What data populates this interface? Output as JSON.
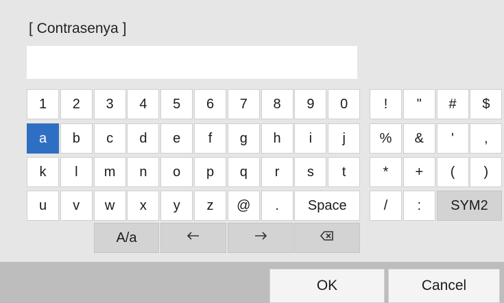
{
  "dialog": {
    "title": "[ Contrasenya ]",
    "password_value": ""
  },
  "keyboard": {
    "selected_key": "a",
    "main_rows": [
      [
        "1",
        "2",
        "3",
        "4",
        "5",
        "6",
        "7",
        "8",
        "9",
        "0"
      ],
      [
        "a",
        "b",
        "c",
        "d",
        "e",
        "f",
        "g",
        "h",
        "i",
        "j"
      ],
      [
        "k",
        "l",
        "m",
        "n",
        "o",
        "p",
        "q",
        "r",
        "s",
        "t"
      ],
      [
        "u",
        "v",
        "w",
        "x",
        "y",
        "z",
        "@",
        "."
      ]
    ],
    "space_label": "Space",
    "shift_label": "A/a",
    "cursor_left_icon": "arrow-left-icon",
    "cursor_right_icon": "arrow-right-icon",
    "backspace_icon": "backspace-icon",
    "symbol_rows": [
      [
        "!",
        "\"",
        "#",
        "$"
      ],
      [
        "%",
        "&",
        "'",
        ","
      ],
      [
        "*",
        "+",
        "(",
        ")"
      ],
      [
        "/",
        ":"
      ]
    ],
    "sym_toggle_label": "SYM2"
  },
  "footer": {
    "ok_label": "OK",
    "cancel_label": "Cancel"
  },
  "colors": {
    "selected_key_bg": "#2f6fc3",
    "function_key_bg": "#d3d3d3",
    "footer_bg": "#bdbdbd"
  }
}
